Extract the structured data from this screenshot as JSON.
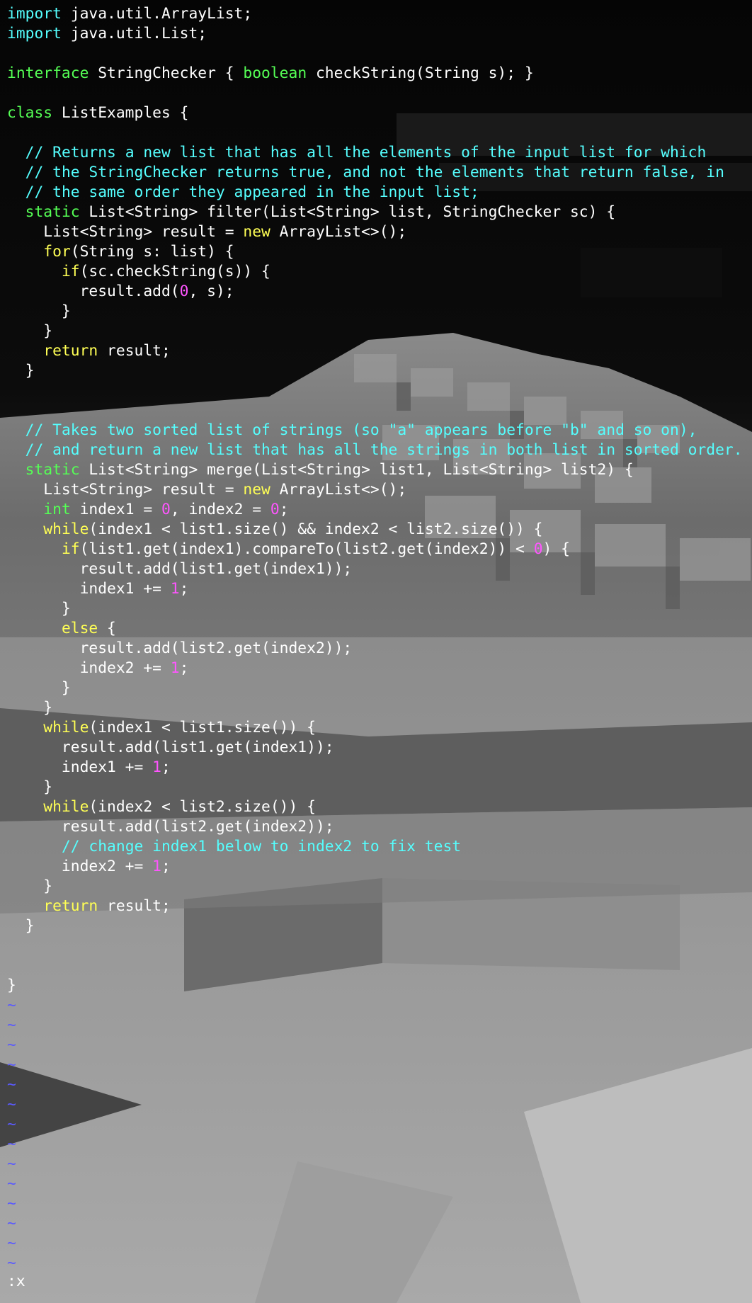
{
  "colors": {
    "keyword_control": "#ffff55",
    "keyword_type": "#55ff55",
    "keyword_import": "#55ffff",
    "comment": "#55ffff",
    "number": "#ff55ff",
    "plain": "#ffffff",
    "tilde": "#5a5aff"
  },
  "buffer": [
    [
      [
        "k_import",
        "import"
      ],
      [
        "p",
        " java.util.ArrayList;"
      ]
    ],
    [
      [
        "k_import",
        "import"
      ],
      [
        "p",
        " java.util.List;"
      ]
    ],
    [],
    [
      [
        "k_type",
        "interface"
      ],
      [
        "p",
        " StringChecker { "
      ],
      [
        "k_type",
        "boolean"
      ],
      [
        "p",
        " checkString(String s); }"
      ]
    ],
    [],
    [
      [
        "k_type",
        "class"
      ],
      [
        "p",
        " ListExamples {"
      ]
    ],
    [],
    [
      [
        "p",
        "  "
      ],
      [
        "c",
        "// Returns a new list that has all the elements of the input list for which"
      ]
    ],
    [
      [
        "p",
        "  "
      ],
      [
        "c",
        "// the StringChecker returns true, and not the elements that return false, in"
      ]
    ],
    [
      [
        "p",
        "  "
      ],
      [
        "c",
        "// the same order they appeared in the input list;"
      ]
    ],
    [
      [
        "p",
        "  "
      ],
      [
        "k_type",
        "static"
      ],
      [
        "p",
        " List<String> filter(List<String> list, StringChecker sc) {"
      ]
    ],
    [
      [
        "p",
        "    List<String> result = "
      ],
      [
        "k_ctrl",
        "new"
      ],
      [
        "p",
        " ArrayList<>();"
      ]
    ],
    [
      [
        "p",
        "    "
      ],
      [
        "k_ctrl",
        "for"
      ],
      [
        "p",
        "(String s: list) {"
      ]
    ],
    [
      [
        "p",
        "      "
      ],
      [
        "k_ctrl",
        "if"
      ],
      [
        "p",
        "(sc.checkString(s)) {"
      ]
    ],
    [
      [
        "p",
        "        result.add("
      ],
      [
        "n",
        "0"
      ],
      [
        "p",
        ", s);"
      ]
    ],
    [
      [
        "p",
        "      }"
      ]
    ],
    [
      [
        "p",
        "    }"
      ]
    ],
    [
      [
        "p",
        "    "
      ],
      [
        "k_ctrl",
        "return"
      ],
      [
        "p",
        " result;"
      ]
    ],
    [
      [
        "p",
        "  }"
      ]
    ],
    [],
    [],
    [
      [
        "p",
        "  "
      ],
      [
        "c",
        "// Takes two sorted list of strings (so \"a\" appears before \"b\" and so on),"
      ]
    ],
    [
      [
        "p",
        "  "
      ],
      [
        "c",
        "// and return a new list that has all the strings in both list in sorted order."
      ]
    ],
    [
      [
        "p",
        "  "
      ],
      [
        "k_type",
        "static"
      ],
      [
        "p",
        " List<String> merge(List<String> list1, List<String> list2) {"
      ]
    ],
    [
      [
        "p",
        "    List<String> result = "
      ],
      [
        "k_ctrl",
        "new"
      ],
      [
        "p",
        " ArrayList<>();"
      ]
    ],
    [
      [
        "p",
        "    "
      ],
      [
        "k_type",
        "int"
      ],
      [
        "p",
        " index1 = "
      ],
      [
        "n",
        "0"
      ],
      [
        "p",
        ", index2 = "
      ],
      [
        "n",
        "0"
      ],
      [
        "p",
        ";"
      ]
    ],
    [
      [
        "p",
        "    "
      ],
      [
        "k_ctrl",
        "while"
      ],
      [
        "p",
        "(index1 < list1.size() && index2 < list2.size()) {"
      ]
    ],
    [
      [
        "p",
        "      "
      ],
      [
        "k_ctrl",
        "if"
      ],
      [
        "p",
        "(list1.get(index1).compareTo(list2.get(index2)) < "
      ],
      [
        "n",
        "0"
      ],
      [
        "p",
        ") {"
      ]
    ],
    [
      [
        "p",
        "        result.add(list1.get(index1));"
      ]
    ],
    [
      [
        "p",
        "        index1 += "
      ],
      [
        "n",
        "1"
      ],
      [
        "p",
        ";"
      ]
    ],
    [
      [
        "p",
        "      }"
      ]
    ],
    [
      [
        "p",
        "      "
      ],
      [
        "k_ctrl",
        "else"
      ],
      [
        "p",
        " {"
      ]
    ],
    [
      [
        "p",
        "        result.add(list2.get(index2));"
      ]
    ],
    [
      [
        "p",
        "        index2 += "
      ],
      [
        "n",
        "1"
      ],
      [
        "p",
        ";"
      ]
    ],
    [
      [
        "p",
        "      }"
      ]
    ],
    [
      [
        "p",
        "    }"
      ]
    ],
    [
      [
        "p",
        "    "
      ],
      [
        "k_ctrl",
        "while"
      ],
      [
        "p",
        "(index1 < list1.size()) {"
      ]
    ],
    [
      [
        "p",
        "      result.add(list1.get(index1));"
      ]
    ],
    [
      [
        "p",
        "      index1 += "
      ],
      [
        "n",
        "1"
      ],
      [
        "p",
        ";"
      ]
    ],
    [
      [
        "p",
        "    }"
      ]
    ],
    [
      [
        "p",
        "    "
      ],
      [
        "k_ctrl",
        "while"
      ],
      [
        "p",
        "(index2 < list2.size()) {"
      ]
    ],
    [
      [
        "p",
        "      result.add(list2.get(index2));"
      ]
    ],
    [
      [
        "p",
        "      "
      ],
      [
        "c",
        "// change index1 below to index2 to fix test"
      ]
    ],
    [
      [
        "p",
        "      index2 += "
      ],
      [
        "n",
        "1"
      ],
      [
        "p",
        ";"
      ]
    ],
    [
      [
        "p",
        "    }"
      ]
    ],
    [
      [
        "p",
        "    "
      ],
      [
        "k_ctrl",
        "return"
      ],
      [
        "p",
        " result;"
      ]
    ],
    [
      [
        "p",
        "  }"
      ]
    ],
    [],
    [],
    [
      [
        "p",
        "}"
      ]
    ]
  ],
  "empty_line_marker": "~",
  "empty_line_count": 14,
  "command_line": ":x"
}
